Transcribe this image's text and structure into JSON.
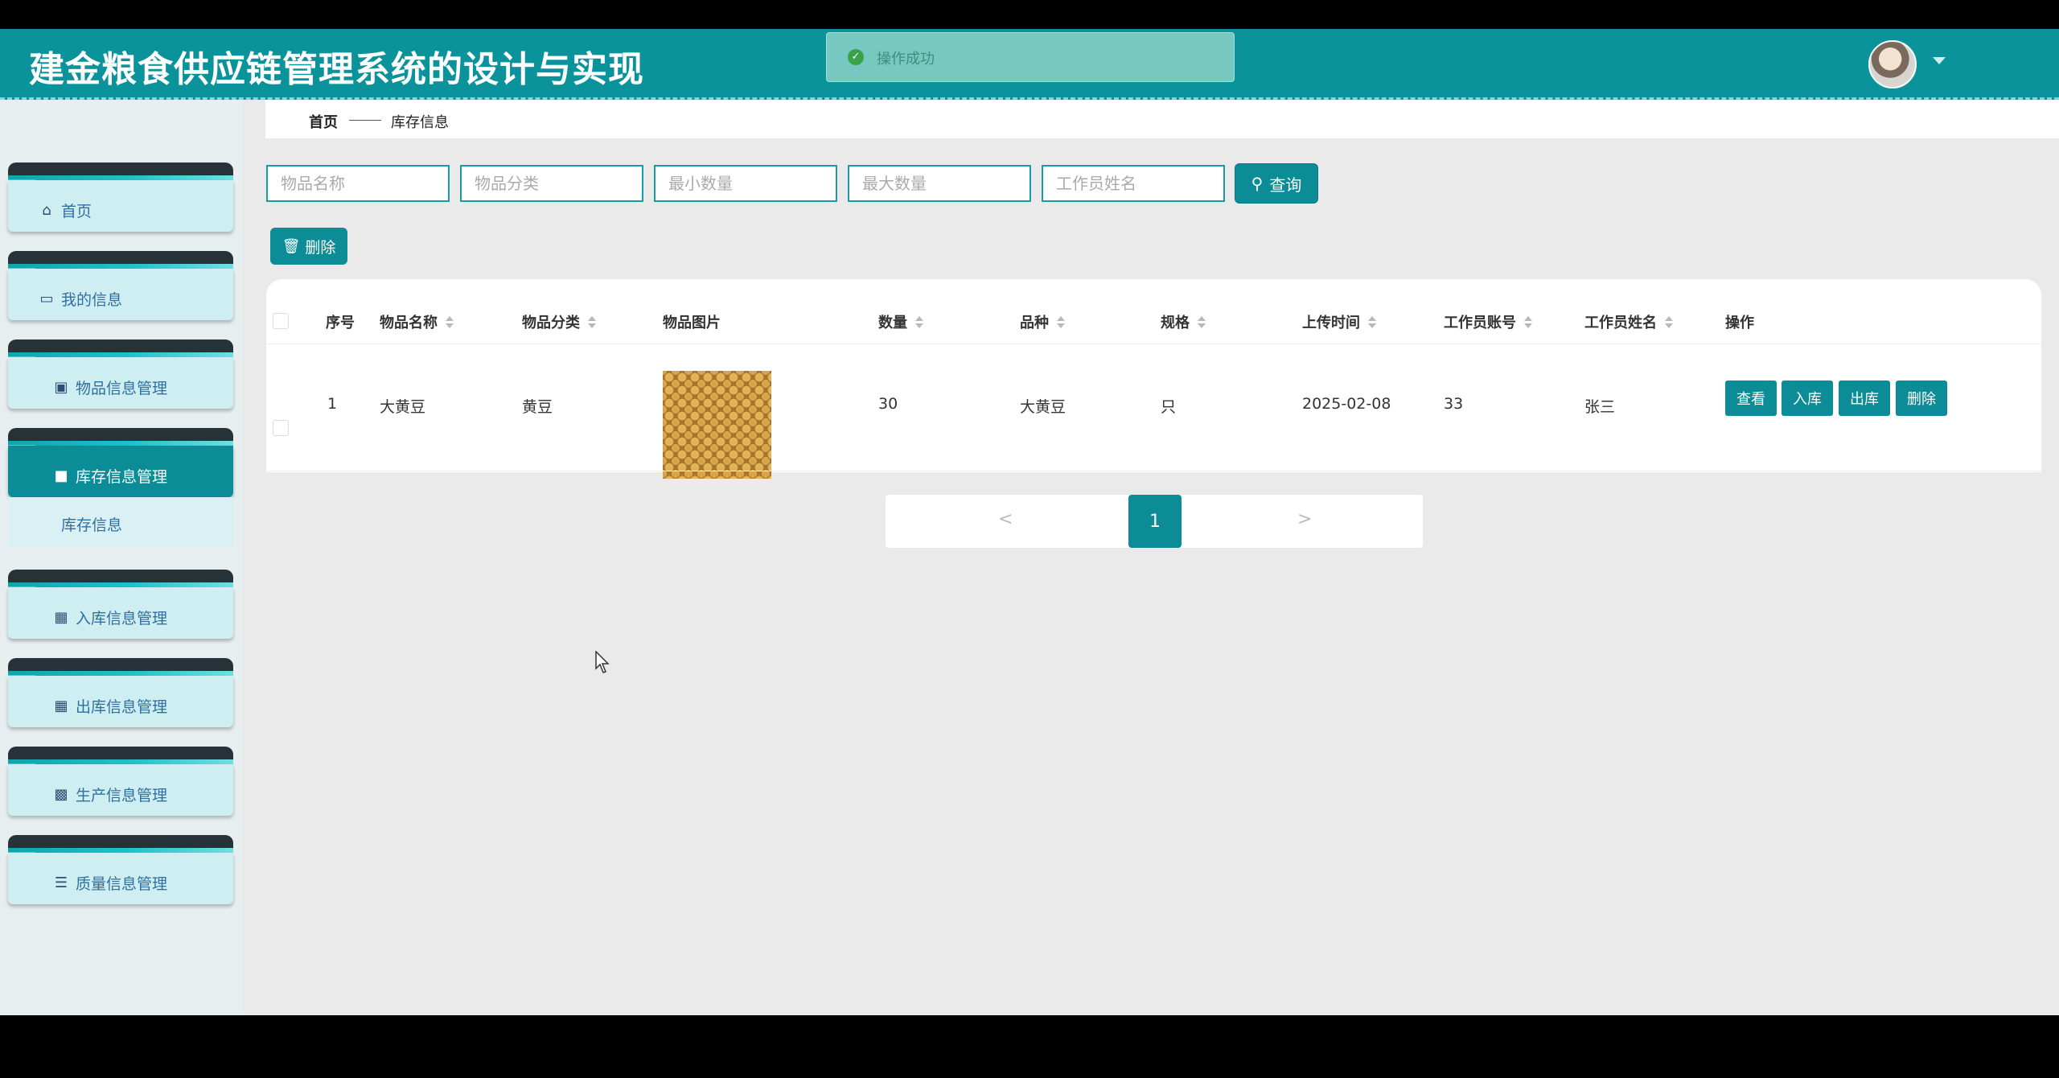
{
  "header": {
    "title": "建金粮食供应链管理系统的设计与实现",
    "toast": "操作成功"
  },
  "sidebar": {
    "items": [
      {
        "label": "首页",
        "icon": "home-icon"
      },
      {
        "label": "我的信息",
        "icon": "card-icon"
      },
      {
        "label": "物品信息管理",
        "icon": "clipboard-check-icon"
      },
      {
        "label": "库存信息管理",
        "icon": "briefcase-icon",
        "active": true
      },
      {
        "label": "入库信息管理",
        "icon": "grid-icon"
      },
      {
        "label": "出库信息管理",
        "icon": "grid-icon"
      },
      {
        "label": "生产信息管理",
        "icon": "grid-9-icon"
      },
      {
        "label": "质量信息管理",
        "icon": "sliders-icon"
      }
    ],
    "sub_item": "库存信息"
  },
  "breadcrumb": {
    "home": "首页",
    "current": "库存信息"
  },
  "search": {
    "item_name_placeholder": "物品名称",
    "category_placeholder": "物品分类",
    "min_qty_placeholder": "最小数量",
    "max_qty_placeholder": "最大数量",
    "worker_name_placeholder": "工作员姓名",
    "query_label": "查询"
  },
  "toolbar": {
    "delete_label": "删除"
  },
  "table": {
    "headers": [
      "序号",
      "物品名称",
      "物品分类",
      "物品图片",
      "数量",
      "品种",
      "规格",
      "上传时间",
      "工作员账号",
      "工作员姓名",
      "操作"
    ],
    "rows": [
      {
        "index": "1",
        "name": "大黄豆",
        "category": "黄豆",
        "quantity": "30",
        "variety": "大黄豆",
        "spec": "只",
        "upload_time": "2025-02-08",
        "worker_account": "33",
        "worker_name": "张三"
      }
    ],
    "actions": {
      "view": "查看",
      "stock_in": "入库",
      "stock_out": "出库",
      "delete": "删除"
    }
  },
  "pagination": {
    "prev": "<",
    "current": "1",
    "next": ">"
  },
  "colors": {
    "primary": "#0b8c96",
    "header": "#0b939c",
    "toast_bg": "#78c8c2"
  }
}
